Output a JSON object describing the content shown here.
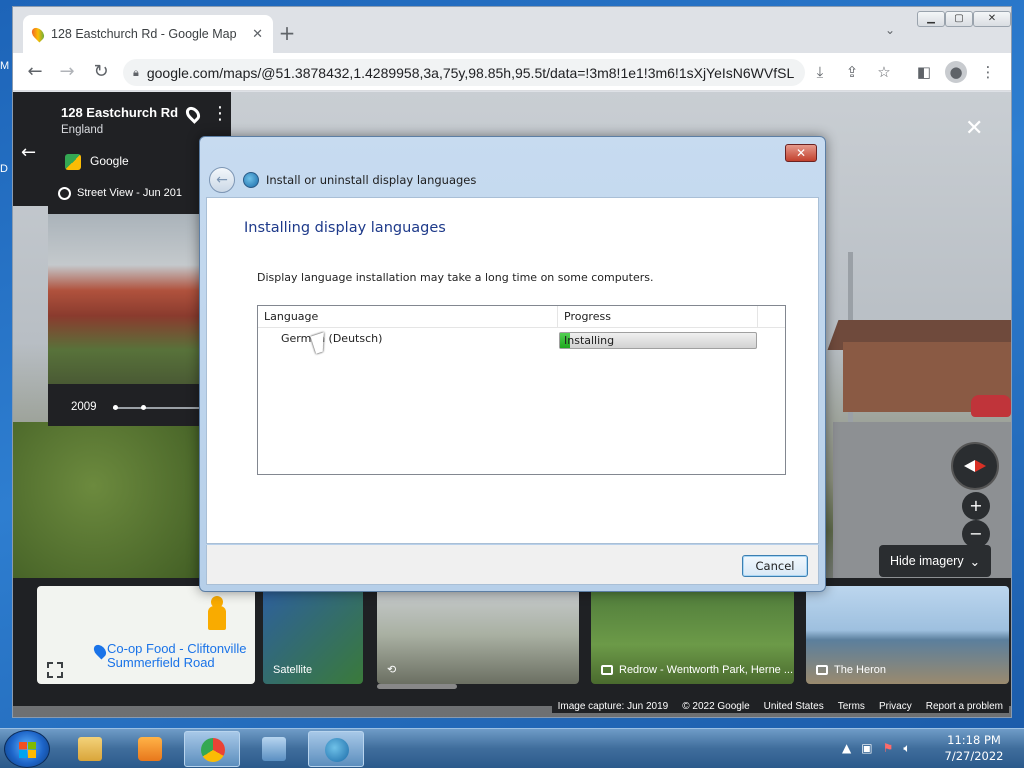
{
  "desktop": {
    "letters": [
      "M",
      "D"
    ]
  },
  "browser": {
    "tab_title": "128 Eastchurch Rd - Google Map",
    "tab_close": "✕",
    "new_tab": "+",
    "url": "google.com/maps/@51.3878432,1.4289958,3a,75y,98.85h,95.5t/data=!3m8!1e1!3m6!1sXjYeIsN6WVfSL..."
  },
  "maps": {
    "place_title": "128 Eastchurch Rd",
    "place_sub": "England",
    "provider": "Google",
    "timebar_text": "Street View - Jun 201",
    "year_label": "2009",
    "close": "✕",
    "zoom_in": "+",
    "zoom_out": "−",
    "hide_imagery": "Hide imagery",
    "cards": [
      {
        "label": "Co-op Food - Cliftonville"
      },
      {
        "label": "Summerfield Road"
      },
      {
        "label": "Satellite"
      },
      {
        "label": "Redrow - Wentworth Park, Herne ..."
      },
      {
        "label": "The Heron"
      }
    ],
    "footer": [
      "Image capture: Jun 2019",
      "© 2022 Google",
      "United States",
      "Terms",
      "Privacy",
      "Report a problem"
    ]
  },
  "dialog": {
    "window_title": "Install or uninstall display languages",
    "close_glyph": "✕",
    "heading": "Installing display languages",
    "description": "Display language installation may take a long time on some computers.",
    "columns": [
      "Language",
      "Progress"
    ],
    "rows": [
      {
        "language": "German (Deutsch)",
        "progress_text": "Installing",
        "progress_fraction": 0.05
      }
    ],
    "cancel": "Cancel"
  },
  "taskbar": {
    "time": "11:18 PM",
    "date": "7/27/2022"
  }
}
